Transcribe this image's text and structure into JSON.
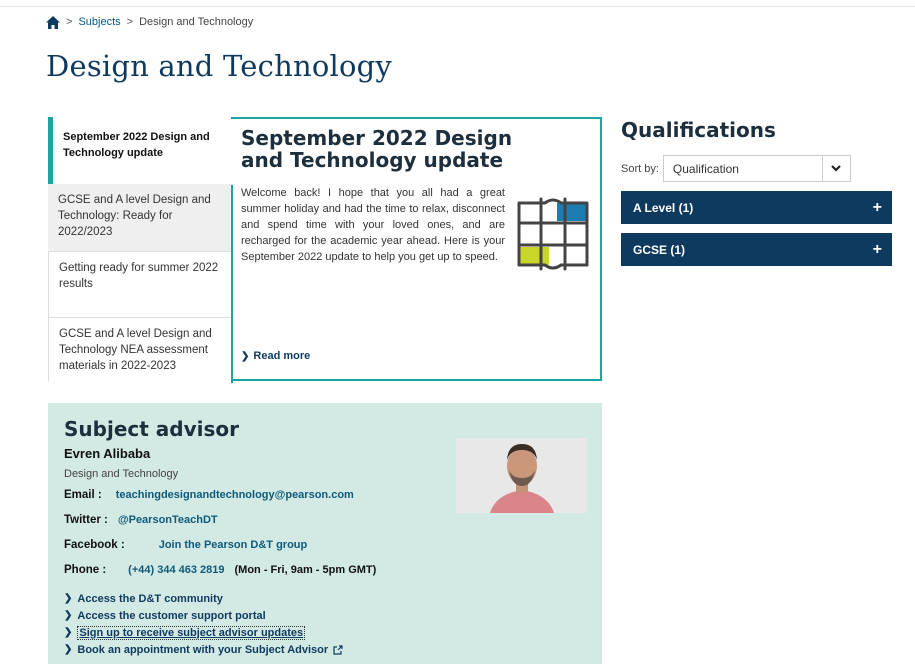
{
  "breadcrumb": {
    "sep": ">",
    "items": [
      "Subjects",
      "Design and Technology"
    ]
  },
  "page": {
    "title": "Design and Technology"
  },
  "updates": {
    "tabs": [
      {
        "label": "September 2022 Design and Technology update"
      },
      {
        "label": "GCSE and A level Design and Technology: Ready for 2022/2023"
      },
      {
        "label": "Getting ready for summer 2022 results"
      },
      {
        "label": "GCSE and A level Design and Technology NEA assessment materials in 2022-2023"
      }
    ],
    "active": {
      "title": "September 2022 Design and Technology update",
      "body": "Welcome back! I hope that you all had a great summer holiday and had the time to relax, disconnect and spend time with your loved ones, and are recharged for the academic year ahead. Here is your September 2022 update to help you get up to speed.",
      "read_more": "Read more"
    },
    "colors": {
      "accent": "#1aa5a0"
    }
  },
  "qualifications": {
    "title": "Qualifications",
    "sort_label": "Sort by:",
    "sort_value": "Qualification",
    "items": [
      {
        "label": "A Level (1)"
      },
      {
        "label": "GCSE (1)"
      }
    ],
    "plus": "+"
  },
  "advisor": {
    "title": "Subject advisor",
    "name": "Evren Alibaba",
    "subject": "Design and Technology",
    "email_label": "Email :",
    "email": "teachingdesignandtechnology@pearson.com",
    "twitter_label": "Twitter :",
    "twitter": "@PearsonTeachDT",
    "facebook_label": "Facebook :",
    "facebook": "Join the Pearson D&T group",
    "phone_label": "Phone :",
    "phone": "(+44) 344 463 2819",
    "phone_hours": "(Mon - Fri, 9am - 5pm GMT)",
    "links": [
      "Access the D&T community",
      "Access the customer support portal",
      "Sign up to receive subject advisor updates",
      "Book an appointment with your Subject Advisor"
    ]
  },
  "colors": {
    "navy": "#0e3a5f",
    "advisor_bg": "#d3e9e3",
    "teal": "#1aa5a0"
  }
}
